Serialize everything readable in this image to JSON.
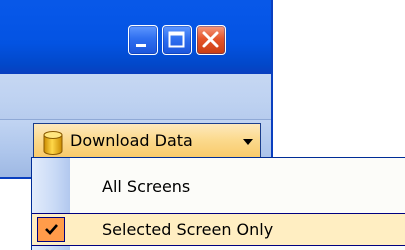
{
  "window": {
    "caption_buttons": [
      {
        "name": "minimize",
        "icon": "minimize-icon"
      },
      {
        "name": "maximize",
        "icon": "maximize-icon"
      },
      {
        "name": "close",
        "icon": "close-icon"
      }
    ]
  },
  "toolbar": {
    "download_button": {
      "label": "Download Data",
      "icon": "database-icon",
      "dropdown_icon": "chevron-down-icon"
    }
  },
  "menu": {
    "items": [
      {
        "label": "All Screens",
        "checked": false
      },
      {
        "label": "Selected Screen Only",
        "checked": true
      }
    ]
  },
  "colors": {
    "titlebar": "#0757e8",
    "toolbar": "#b9cef0",
    "hover_highlight": "#fbd98c",
    "selected_item": "#ffeec2",
    "check_box": "#ff9c4a",
    "close_button": "#e5562c"
  }
}
